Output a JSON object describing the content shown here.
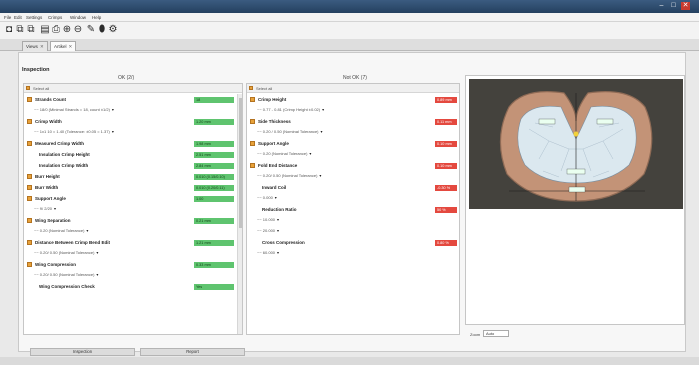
{
  "window": {
    "minimize": "–",
    "maximize": "□",
    "close": "✕"
  },
  "menu": [
    "File",
    "Edit",
    "Settings",
    "Crimps",
    "Window",
    "Help"
  ],
  "toolbar": {
    "icons": [
      "camera-icon",
      "new-icon",
      "open-icon",
      "save-icon",
      "print-icon",
      "zoom-in-icon",
      "zoom-out-icon",
      "tools-icon",
      "measure-icon",
      "settings-icon"
    ],
    "glyphs": [
      "◘",
      "⧉",
      "⧉",
      "▤",
      "⎙",
      "⊕",
      "⊖",
      "✎",
      "⬮",
      "⚙"
    ]
  },
  "tabs": [
    {
      "label": "Views",
      "close": "✕"
    },
    {
      "label": "Artikel",
      "close": "✕"
    }
  ],
  "section_title": "Inspection",
  "left_column": {
    "header": "OK (2/)",
    "select_all": "Select all",
    "rows": [
      {
        "type": "main",
        "name": "Strands Count",
        "value": "18",
        "color": "green"
      },
      {
        "type": "sub",
        "text": "~~ 18/0 (Minimal Strands = 18, count ±1/2)"
      },
      {
        "type": "main",
        "name": "Crimp Width",
        "value": "1.20 mm",
        "color": "green"
      },
      {
        "type": "sub",
        "text": "~~ 1x1 10 = 1.40 (Tolerance: ±0.05 = 1.37)"
      },
      {
        "type": "main",
        "name": "Measured Crimp Width",
        "value": "1.98 mm",
        "color": "green"
      },
      {
        "type": "plain",
        "name": "Insulation Crimp Height",
        "value": "2.51 mm",
        "color": "green"
      },
      {
        "type": "plain",
        "name": "Insulation Crimp Width",
        "value": "2.84 mm",
        "color": "green"
      },
      {
        "type": "main",
        "name": "Burr Height",
        "value": "0.010 (0.15/0.10)",
        "color": "green"
      },
      {
        "type": "main",
        "name": "Burr Width",
        "value": "0.010 (0.20/0.11)",
        "color": "green"
      },
      {
        "type": "main",
        "name": "Support Angle",
        "value": "1.00",
        "color": "green"
      },
      {
        "type": "sub",
        "text": "~~ 9/ 2/20"
      },
      {
        "type": "main",
        "name": "Wing Separation",
        "value": "0.21 mm",
        "color": "green"
      },
      {
        "type": "sub",
        "text": "~~ 0.20 (Nominal Tolerance)"
      },
      {
        "type": "main",
        "name": "Distance Between Crimp Bend Edit",
        "value": "1.21 mm",
        "color": "green"
      },
      {
        "type": "sub",
        "text": "~~ 0.20/ 0.50 (Nominal Tolerance)"
      },
      {
        "type": "main",
        "name": "Wing Compression",
        "value": "0.33 mm",
        "color": "green"
      },
      {
        "type": "sub",
        "text": "~~ 0.20/ 0.50 (Nominal Tolerance)"
      },
      {
        "type": "plain",
        "name": "Wing Compression Check",
        "value": "Yes",
        "color": "green"
      }
    ]
  },
  "right_column": {
    "header": "Not OK (7)",
    "select_all": "Select all",
    "rows": [
      {
        "type": "main",
        "name": "Crimp Height",
        "value": "0.89 mm",
        "color": "red"
      },
      {
        "type": "sub",
        "text": "~~ 0.77 - 0.81 (Crimp Height ±0.02)"
      },
      {
        "type": "main",
        "name": "Side Thickness",
        "value": "0.11 mm",
        "color": "red"
      },
      {
        "type": "sub",
        "text": "~~ 0.20 / 0.50 (Nominal Tolerance)"
      },
      {
        "type": "main",
        "name": "Support Angle",
        "value": "0.10 mm",
        "color": "red"
      },
      {
        "type": "sub",
        "text": "~~ 0.20 (Nominal Tolerance)"
      },
      {
        "type": "main",
        "name": "Fold End Distance",
        "value": "0.10 mm",
        "color": "red"
      },
      {
        "type": "sub",
        "text": "~~ 0.20/ 0.50 (Nominal Tolerance)"
      },
      {
        "type": "plain",
        "name": "Inward Coil",
        "value": "-0.30 %",
        "color": "red"
      },
      {
        "type": "sub",
        "text": "~~ 0.000"
      },
      {
        "type": "plain",
        "name": "Reduction Ratio",
        "value": "50 %",
        "color": "red"
      },
      {
        "type": "sub",
        "text": "~~ 10.000"
      },
      {
        "type": "sub",
        "text": "~~ 20.000"
      },
      {
        "type": "plain",
        "name": "Cross Compression",
        "value": "0.80 %",
        "color": "red"
      },
      {
        "type": "sub",
        "text": "~~ 60.000"
      }
    ]
  },
  "image_panel": {
    "zoom_label": "Zoom",
    "zoom_value": "Auto"
  },
  "buttons": {
    "inspection": "Inspection",
    "report": "Report"
  },
  "colors": {
    "ok": "#5fc46f",
    "not_ok": "#e4493f",
    "checkbox": "#e8a23a",
    "titlebar": "#2b4a6b"
  }
}
